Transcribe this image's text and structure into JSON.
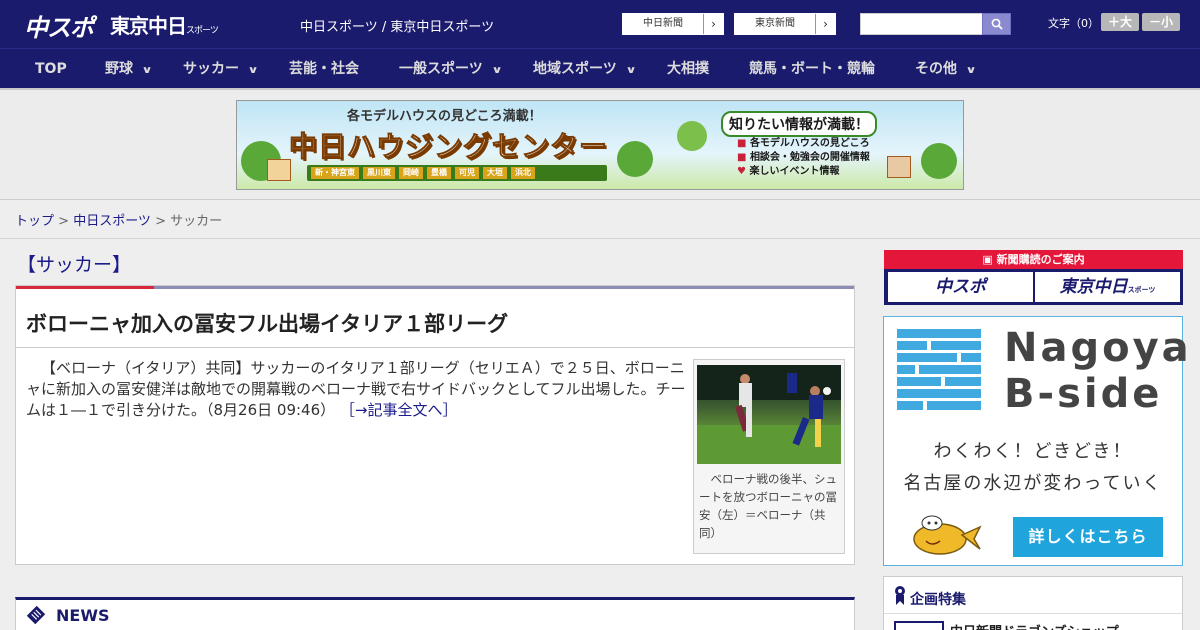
{
  "header": {
    "logo_main": "中スポ",
    "logo_sub": "東京中日",
    "logo_sub_small": "スポーツ",
    "site_title": "中日スポーツ / 東京中日スポーツ",
    "link_chunichi": "中日新聞",
    "link_tokyo": "東京新聞",
    "arrow": "›",
    "search_placeholder": "",
    "fontsize_label": "文字（0）",
    "fontsize_big": "＋大",
    "fontsize_small": "－小"
  },
  "nav": {
    "items": [
      {
        "label": "TOP",
        "dropdown": false
      },
      {
        "label": "野球",
        "dropdown": true
      },
      {
        "label": "サッカー",
        "dropdown": true
      },
      {
        "label": "芸能・社会",
        "dropdown": false
      },
      {
        "label": "一般スポーツ",
        "dropdown": true
      },
      {
        "label": "地域スポーツ",
        "dropdown": true
      },
      {
        "label": "大相撲",
        "dropdown": false
      },
      {
        "label": "競馬・ボート・競輪",
        "dropdown": false
      },
      {
        "label": "その他",
        "dropdown": true
      }
    ],
    "chevron": "∨"
  },
  "banner": {
    "top": "各モデルハウスの見どころ満載！",
    "main": "中日ハウジングセンター",
    "areas": [
      "新・神宮東",
      "黒川東",
      "岡崎",
      "豊橋",
      "可児",
      "大垣",
      "浜北"
    ],
    "right_title": "知りたい情報が満載！",
    "right_items": [
      "各モデルハウスの見どころ",
      "相談会・勉強会の開催情報",
      "楽しいイベント情報"
    ]
  },
  "breadcrumb": {
    "top": "トップ",
    "section": "中日スポーツ",
    "current": "サッカー",
    "sep": " > "
  },
  "main": {
    "category": "【サッカー】",
    "article": {
      "title": "ボローニャ加入の冨安フル出場イタリア１部リーグ",
      "body": "【ベローナ（イタリア）共同】サッカーのイタリア１部リーグ（セリエＡ）で２５日、ボローニャに新加入の冨安健洋は敵地での開幕戦のベローナ戦で右サイドバックとしてフル出場した。チームは１―１で引き分けた。（8月26日 09:46）",
      "more_link": "［→記事全文へ］",
      "photo_caption": "ベローナ戦の後半、シュートを放つボローニャの冨安（左）＝ベローナ（共同）"
    },
    "news_title": "NEWS"
  },
  "sidebar": {
    "subscribe_head": "新聞購読のご案内",
    "sub_btn1": "中スポ",
    "sub_btn2": "東京中日",
    "sub_btn2_small": "スポーツ",
    "bside_title_1": "Nagoya",
    "bside_title_2": "B-side",
    "bside_text_1": "わくわく！どきどき！",
    "bside_text_2": "名古屋の水辺が変わっていく",
    "bside_button": "詳しくはこちら",
    "kikaku_head": "企画特集",
    "kikaku_item": "中日新聞ドラゴンズショップ"
  },
  "colors": {
    "header_bg": "#1b1b6e",
    "accent_red": "#d9283a",
    "link": "#1b1b8a",
    "bside_blue": "#1fa4dc"
  }
}
